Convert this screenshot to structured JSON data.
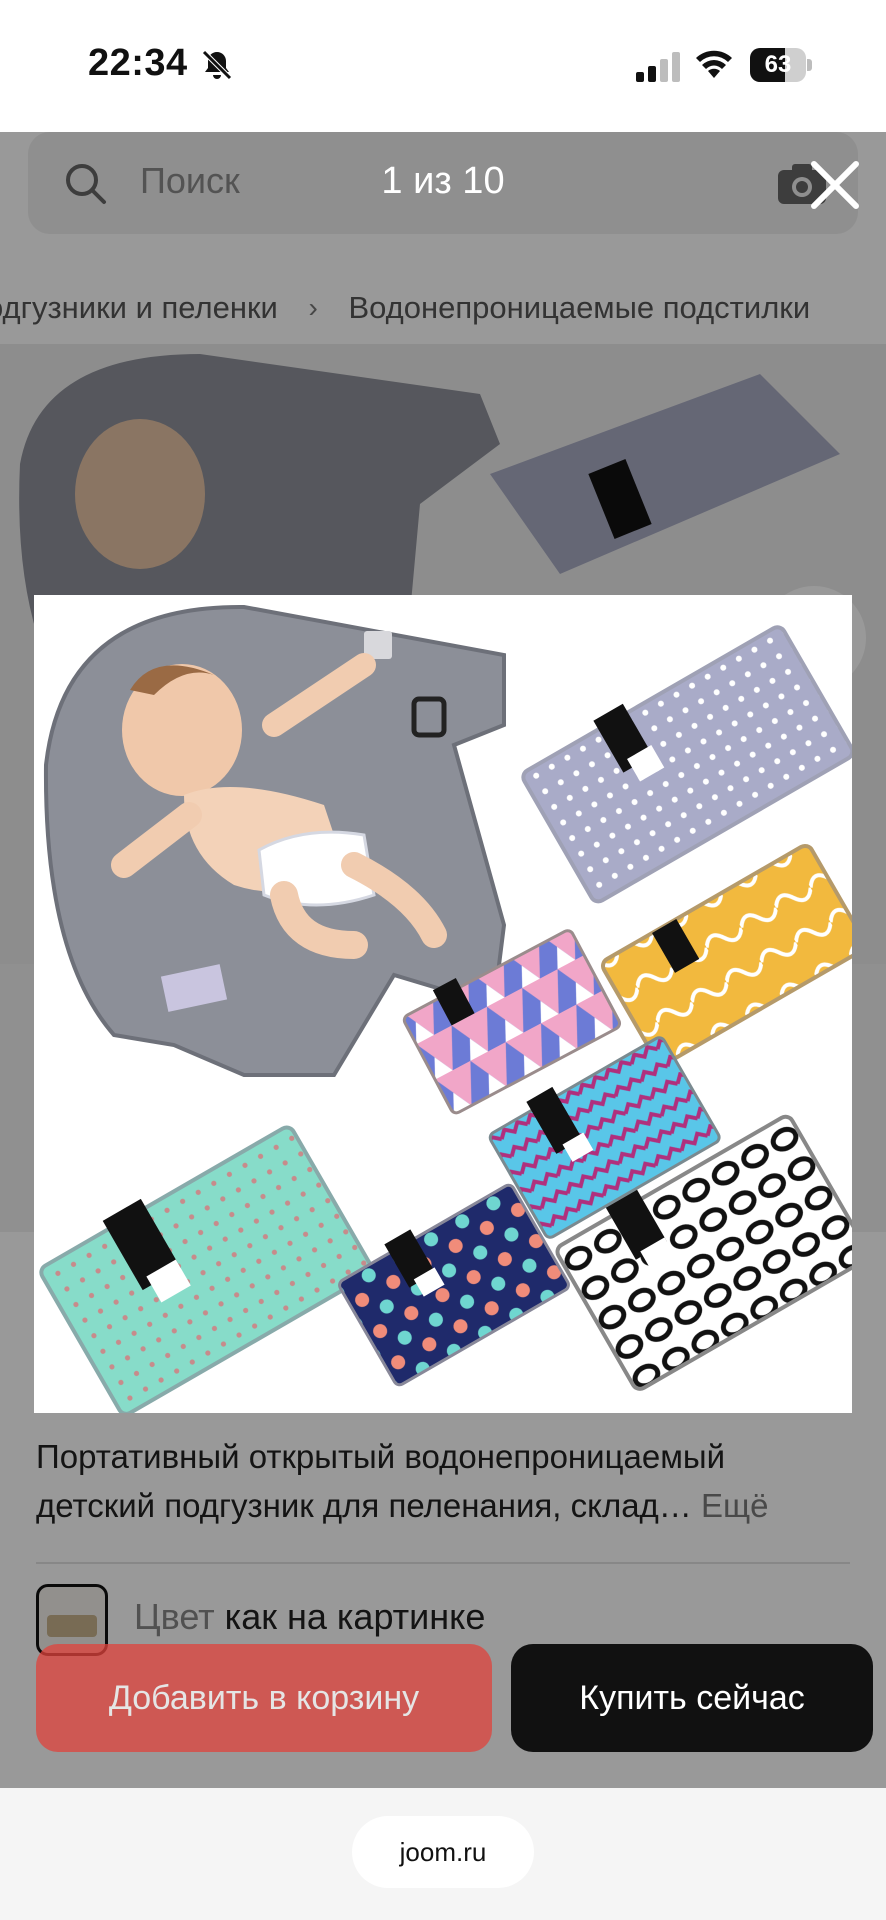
{
  "status_bar": {
    "time": "22:34",
    "battery_level": 63,
    "battery_percent": 0.63,
    "icons": [
      "bell-slash-icon",
      "cellular-signal-icon",
      "wifi-icon",
      "battery-icon"
    ]
  },
  "search": {
    "placeholder": "Поиск",
    "icons": [
      "search-icon",
      "camera-icon"
    ]
  },
  "breadcrumb": {
    "items": [
      "одгузники и пеленки",
      "Водонепроницаемые подстилки"
    ]
  },
  "gallery": {
    "favorite_icon": "heart-icon"
  },
  "viewer": {
    "counter": "1 из 10",
    "close_icon": "close-icon"
  },
  "product": {
    "title_line1": "Портативный открытый водонепроницаемый",
    "title_line2": "детский подгузник для пеленания, склад…",
    "more_label": "Ещё",
    "variant_label": "Цвет",
    "variant_value": "как на картинке"
  },
  "actions": {
    "add_to_cart": "Добавить в корзину",
    "buy_now": "Купить сейчас"
  },
  "browser": {
    "url": "joom.ru"
  },
  "colors": {
    "accent_red": "#e0433c",
    "button_dark": "#111111",
    "overlay": "rgba(0,0,0,0.40)"
  }
}
